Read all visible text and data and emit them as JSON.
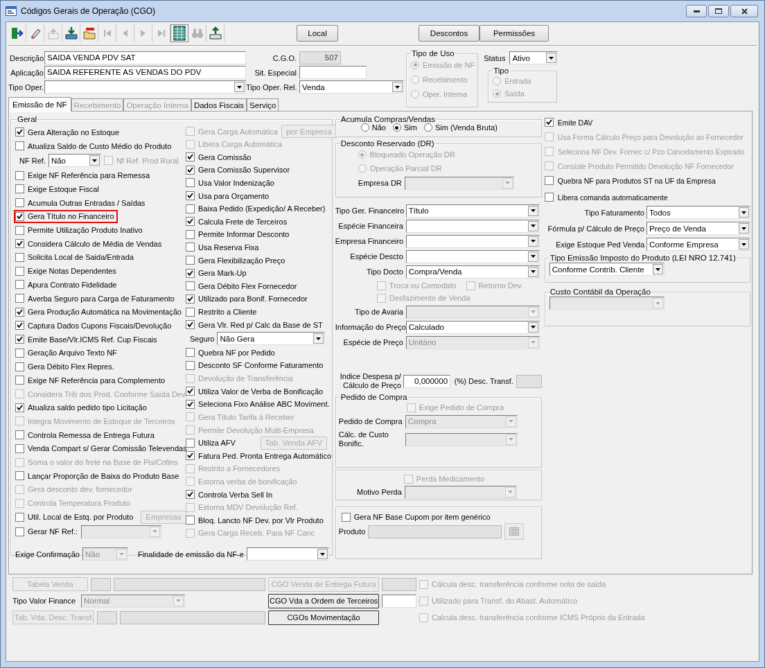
{
  "window": {
    "title": "Códigos Gerais de Operação (CGO)"
  },
  "toolbar": {
    "tools": [
      {
        "kind": "exit",
        "disabled": false
      },
      {
        "kind": "edit",
        "disabled": false
      },
      {
        "kind": "add",
        "disabled": true
      },
      {
        "kind": "download",
        "disabled": false
      },
      {
        "kind": "folder",
        "disabled": false
      },
      {
        "kind": "first",
        "disabled": true
      },
      {
        "kind": "prev",
        "disabled": true
      },
      {
        "kind": "next",
        "disabled": true
      },
      {
        "kind": "last",
        "disabled": true
      },
      {
        "kind": "grid",
        "disabled": false
      },
      {
        "kind": "binoculars",
        "disabled": true
      },
      {
        "kind": "upload",
        "disabled": false
      }
    ],
    "buttons": [
      {
        "label": "Local"
      },
      {
        "label": "Descontos"
      },
      {
        "label": "Permissões"
      }
    ]
  },
  "header": {
    "descricao": {
      "label": "Descrição",
      "value": "SAIDA VENDA PDV SAT"
    },
    "aplicacao": {
      "label": "Aplicação",
      "value": "SAIDA REFERENTE AS VENDAS DO PDV"
    },
    "tipo_oper": {
      "label": "Tipo Oper."
    },
    "cgo": {
      "label": "C.G.O.",
      "value": "507",
      "disabled": true
    },
    "sit_especial": {
      "label": "Sit. Especial"
    },
    "tipo_oper_rel": {
      "label": "Tipo Oper. Rel.",
      "value": "Venda"
    },
    "tipo_de_uso": {
      "title": "Tipo de Uso",
      "disabled": true,
      "options": [
        {
          "label": "Emissão de NF",
          "selected": true
        },
        {
          "label": "Recebimento",
          "selected": false
        },
        {
          "label": "Oper. Interna",
          "selected": false
        }
      ]
    },
    "status": {
      "label": "Status",
      "value": "Ativo"
    },
    "tipo": {
      "title": "Tipo",
      "disabled": true,
      "options": [
        {
          "label": "Entrada",
          "selected": false
        },
        {
          "label": "Saída",
          "selected": true
        }
      ]
    }
  },
  "tabs": [
    {
      "label": "Emissão de NF",
      "selected": true,
      "disabled": false
    },
    {
      "label": "Recebimento",
      "selected": false,
      "disabled": true
    },
    {
      "label": "Operação Interna",
      "selected": false,
      "disabled": true
    },
    {
      "label": "Dados Fiscais",
      "selected": false,
      "disabled": false
    },
    {
      "label": "Serviço",
      "selected": false,
      "disabled": false
    }
  ],
  "geral": {
    "title": "Geral",
    "column_1": [
      {
        "kind": "check",
        "label": "Gera Alteração no Estoque",
        "checked": true,
        "disabled": false,
        "highlighted": false
      },
      {
        "kind": "check",
        "label": "Atualiza Saldo de Custo Médio do Produto",
        "checked": false,
        "disabled": false,
        "highlighted": false
      },
      {
        "kind": "select",
        "label": "NF Ref.",
        "value": "Não",
        "disabled": false,
        "check": {
          "label": "Nf Ref. Prod Rural",
          "checked": false,
          "disabled": true
        },
        "highlighted": false
      },
      {
        "kind": "check",
        "label": "Exige NF Referência para Remessa",
        "checked": false,
        "disabled": false,
        "highlighted": false
      },
      {
        "kind": "check",
        "label": "Exige Estoque Fiscal",
        "checked": false,
        "disabled": false,
        "highlighted": false
      },
      {
        "kind": "check",
        "label": "Acumula Outras Entradas / Saídas",
        "checked": false,
        "disabled": false,
        "highlighted": false
      },
      {
        "kind": "check",
        "label": "Gera Título no Financeiro",
        "checked": true,
        "disabled": false,
        "highlighted": true
      },
      {
        "kind": "check",
        "label": "Permite Utilização Produto Inativo",
        "checked": false,
        "disabled": false,
        "highlighted": false
      },
      {
        "kind": "check",
        "label": "Considera Cálculo de Média de Vendas",
        "checked": true,
        "disabled": false,
        "highlighted": false
      },
      {
        "kind": "check",
        "label": "Solicita Local de Saida/Entrada",
        "checked": false,
        "disabled": false,
        "highlighted": false
      },
      {
        "kind": "check",
        "label": "Exige Notas Dependentes",
        "checked": false,
        "disabled": false,
        "highlighted": false
      },
      {
        "kind": "check",
        "label": "Apura Contrato Fidelidade",
        "checked": false,
        "disabled": false,
        "highlighted": false
      },
      {
        "kind": "check",
        "label": "Averba Seguro para Carga de Faturamento",
        "checked": false,
        "disabled": false,
        "highlighted": false
      },
      {
        "kind": "check",
        "label": "Gera Produção Automática na Movimentação",
        "checked": true,
        "disabled": false,
        "highlighted": false
      },
      {
        "kind": "check",
        "label": "Captura Dados Cupons Fiscais/Devolução",
        "checked": true,
        "disabled": false,
        "highlighted": false
      },
      {
        "kind": "check",
        "label": "Emite Base/Vlr.ICMS Ref. Cup Fiscais",
        "checked": true,
        "disabled": false,
        "highlighted": false
      },
      {
        "kind": "check",
        "label": "Geração Arquivo Texto NF",
        "checked": false,
        "disabled": false,
        "highlighted": false
      },
      {
        "kind": "check",
        "label": "Gera Débito Flex Repres.",
        "checked": false,
        "disabled": false,
        "highlighted": false
      },
      {
        "kind": "check",
        "label": "Exige NF Referência para Complemento",
        "checked": false,
        "disabled": false,
        "highlighted": false
      },
      {
        "kind": "check",
        "label": "Considera Trib dos Prod. Conforme Saída Dev.",
        "checked": false,
        "disabled": true,
        "highlighted": false
      },
      {
        "kind": "check",
        "label": "Atualiza saldo pedido tipo Licitação",
        "checked": true,
        "disabled": false,
        "highlighted": false
      },
      {
        "kind": "check",
        "label": "Integra Movimento de Estoque de Terceiros",
        "checked": false,
        "disabled": true,
        "highlighted": false
      },
      {
        "kind": "check",
        "label": "Controla Remessa de Entrega Futura",
        "checked": false,
        "disabled": false,
        "highlighted": false
      },
      {
        "kind": "check",
        "label": "Venda Compart s/ Gerar Comissão Televendas",
        "checked": false,
        "disabled": false,
        "highlighted": false
      },
      {
        "kind": "check",
        "label": "Soma o valor do frete na Base de Pis/Cofins",
        "checked": false,
        "disabled": true,
        "highlighted": false
      },
      {
        "kind": "check",
        "label": "Lançar Proporção de Baixa do Produto Base",
        "checked": false,
        "disabled": false,
        "highlighted": false
      },
      {
        "kind": "check",
        "label": "Gera desconto dev. fornecedor",
        "checked": false,
        "disabled": true,
        "highlighted": false
      },
      {
        "kind": "check",
        "label": "Controla Temperatura Produto",
        "checked": false,
        "disabled": true,
        "highlighted": false
      },
      {
        "kind": "check",
        "label": "Util. Local de Estq. por Produto",
        "checked": false,
        "disabled": false,
        "button": {
          "label": "Empresas",
          "disabled": true
        },
        "highlighted": false
      },
      {
        "kind": "check",
        "label": "Gerar NF Ref.:",
        "checked": false,
        "disabled": false,
        "select": {
          "disabled": true
        },
        "highlighted": false
      }
    ],
    "column_2": [
      {
        "kind": "check",
        "label": "Gera Carga Automática",
        "checked": false,
        "disabled": true,
        "button": {
          "label": "por Empresa",
          "disabled": true
        }
      },
      {
        "kind": "check",
        "label": "Libera Carga Automática",
        "checked": false,
        "disabled": true
      },
      {
        "kind": "check",
        "label": "Gera Comissão",
        "checked": true,
        "disabled": false
      },
      {
        "kind": "check",
        "label": "Gera Comissão Supervisor",
        "checked": true,
        "disabled": false
      },
      {
        "kind": "check",
        "label": "Usa Valor Indenização",
        "checked": false,
        "disabled": false
      },
      {
        "kind": "check",
        "label": "Usa para Orçamento",
        "checked": true,
        "disabled": false
      },
      {
        "kind": "check",
        "label": "Baixa Pedido (Expedição/ A Receber)",
        "checked": false,
        "disabled": false
      },
      {
        "kind": "check",
        "label": "Calcula Frete de Terceiros",
        "checked": true,
        "disabled": false
      },
      {
        "kind": "check",
        "label": "Permite Informar Desconto",
        "checked": false,
        "disabled": false
      },
      {
        "kind": "check",
        "label": "Usa Reserva Fixa",
        "checked": false,
        "disabled": false
      },
      {
        "kind": "check",
        "label": "Gera Flexibilização Preço",
        "checked": false,
        "disabled": false
      },
      {
        "kind": "check",
        "label": "Gera Mark-Up",
        "checked": true,
        "disabled": false
      },
      {
        "kind": "check",
        "label": "Gera Débito Flex Fornecedor",
        "checked": false,
        "disabled": false
      },
      {
        "kind": "check",
        "label": "Utilizado para Bonif. Fornecedor",
        "checked": true,
        "disabled": false
      },
      {
        "kind": "check",
        "label": "Restrito a Cliente",
        "checked": false,
        "disabled": false
      },
      {
        "kind": "check",
        "label": "Gera Vlr. Red p/ Calc da Base de ST",
        "checked": true,
        "disabled": false
      },
      {
        "kind": "select",
        "label": "Seguro",
        "value": "Não Gera",
        "disabled": false
      },
      {
        "kind": "check",
        "label": "Quebra NF por Pedido",
        "checked": false,
        "disabled": false
      },
      {
        "kind": "check",
        "label": "Desconto SF Conforme Faturamento",
        "checked": false,
        "disabled": false
      },
      {
        "kind": "check",
        "label": "Devolução de Transferência",
        "checked": false,
        "disabled": true
      },
      {
        "kind": "check",
        "label": "Utiliza Valor de Verba de Bonificação",
        "checked": true,
        "disabled": false
      },
      {
        "kind": "check",
        "label": "Seleciona Fixo Análise ABC Moviment.",
        "checked": true,
        "disabled": false
      },
      {
        "kind": "check",
        "label": "Gera Título Tarifa à Receber",
        "checked": false,
        "disabled": true
      },
      {
        "kind": "check",
        "label": "Permite Devolução Multi-Empresa",
        "checked": false,
        "disabled": true
      },
      {
        "kind": "check",
        "label": "Utiliza AFV",
        "checked": false,
        "disabled": false,
        "button": {
          "label": "Tab. Venda AFV",
          "disabled": true
        }
      },
      {
        "kind": "check",
        "label": "Fatura Ped. Pronta Entrega Automático",
        "checked": true,
        "disabled": false
      },
      {
        "kind": "check",
        "label": "Restrito a Fornecedores",
        "checked": false,
        "disabled": true
      },
      {
        "kind": "check",
        "label": "Estorna verba de bonificação",
        "checked": false,
        "disabled": true
      },
      {
        "kind": "check",
        "label": "Controla Verba Sell In",
        "checked": true,
        "disabled": false
      },
      {
        "kind": "check",
        "label": "Estorna MDV Devolução Ref.",
        "checked": false,
        "disabled": true
      },
      {
        "kind": "check",
        "label": "Bloq. Lancto NF Dev. por Vlr Produto",
        "checked": false,
        "disabled": false
      },
      {
        "kind": "check",
        "label": "Gera Carga Receb. Para NF Canc",
        "checked": false,
        "disabled": true
      }
    ],
    "exige_confirmacao": {
      "label": "Exige Confirmação",
      "value": "Não",
      "disabled": true
    },
    "finalidade": {
      "label": "Finalidade de emissão da NF-e",
      "disabled": false
    }
  },
  "column_3": {
    "acumula": {
      "title": "Acumula Compras/Vendas",
      "options": [
        {
          "label": "Não",
          "selected": false
        },
        {
          "label": "Sim",
          "selected": true
        },
        {
          "label": "Sim (Venda Bruta)",
          "selected": false
        }
      ]
    },
    "desconto_reservado": {
      "title": "Desconto Reservado (DR)",
      "disabled": true,
      "options": [
        {
          "label": "Bloqueado Operação DR",
          "selected": true
        },
        {
          "label": "Operação Parcial DR",
          "selected": false
        }
      ],
      "empresa": {
        "label": "Empresa DR",
        "disabled": true
      }
    },
    "fields": [
      {
        "kind": "select",
        "label": "Tipo Ger. Financeiro",
        "value": "Título",
        "disabled": false
      },
      {
        "kind": "select",
        "label": "Espécie Financeira",
        "disabled": false
      },
      {
        "kind": "select",
        "label": "Empresa Financeiro",
        "disabled": false
      },
      {
        "kind": "select",
        "label": "Espécie Descto",
        "disabled": false
      },
      {
        "kind": "select",
        "label": "Tipo Docto",
        "value": "Compra/Venda",
        "disabled": false
      },
      {
        "kind": "checks",
        "items": [
          {
            "label": "Troca ou Comodato",
            "checked": false,
            "disabled": true
          },
          {
            "label": "Retorno Dev.",
            "checked": false,
            "disabled": true
          }
        ]
      },
      {
        "kind": "checks",
        "items": [
          {
            "label": "Desfazimento de Venda",
            "checked": false,
            "disabled": true
          }
        ]
      },
      {
        "kind": "select",
        "label": "Tipo de Avaria",
        "disabled": true
      },
      {
        "kind": "select",
        "label": "Informação do Preço",
        "value": "Calculado",
        "disabled": false
      },
      {
        "kind": "select",
        "label": "Espécie de Preço",
        "value": "Unitário",
        "disabled": true
      }
    ],
    "indice": {
      "label": "Indice Despesa p/ Cálculo de Preço",
      "value": "0,000000",
      "desc_label": "(%) Desc. Transf."
    },
    "pedido_de_compra": {
      "title": "Pedido de Compra",
      "exige": {
        "label": "Exige Pedido de Compra",
        "checked": false,
        "disabled": true
      },
      "pedido": {
        "label": "Pedido de Compra",
        "value": "Compra",
        "disabled": true
      },
      "calc_custo": {
        "label": "Cálc. de Custo Bonific.",
        "disabled": true
      }
    },
    "perda": {
      "check": {
        "label": "Perda Medicamento",
        "checked": false,
        "disabled": true
      },
      "motivo": {
        "label": "Motivo Perda",
        "disabled": true
      }
    },
    "cupom": {
      "check": {
        "label": "Gera NF Base Cupom por item genérico",
        "checked": false,
        "disabled": false
      },
      "produto": {
        "label": "Produto",
        "disabled": true
      }
    }
  },
  "column_4": {
    "checks": [
      {
        "label": "Emite DAV",
        "checked": true,
        "disabled": false
      },
      {
        "label": "Usa Forma Cálculo Preço para Devolução ao Fornecedor",
        "checked": false,
        "disabled": true
      },
      {
        "label": "Seleciona NF Dev. Fornec c/ Pzo Cancelamento Expirado",
        "checked": false,
        "disabled": true
      },
      {
        "label": "Consiste Produto Permitido Devolução NF Fornecedor",
        "checked": false,
        "disabled": true
      },
      {
        "label": "Quebra NF para Produtos ST na UF da Empresa",
        "checked": false,
        "disabled": false
      },
      {
        "label": "Libera comanda automaticamente",
        "checked": false,
        "disabled": false
      }
    ],
    "selects": [
      {
        "label": "Tipo Faturamento",
        "value": "Todos"
      },
      {
        "label": "Fórmula p/ Cálculo de Preço",
        "value": "Preço de Venda"
      },
      {
        "label": "Exige Estoque Ped Venda",
        "value": "Conforme Empresa"
      }
    ],
    "imposto": {
      "title": "Tipo Emissão Imposto do Produto (LEI NRO 12.741)",
      "value": "Conforme Contrib. Cliente"
    },
    "custo": {
      "title": "Custo Contábil da Operação",
      "disabled": true
    }
  },
  "bottom": [
    {
      "kind": "button",
      "button": {
        "label": "Tabela Venda",
        "disabled": true
      },
      "cgo": {
        "label": "CGO Venda de Entrega Futura",
        "disabled": true,
        "field": {
          "disabled": true
        }
      },
      "check": {
        "label": "Cálcula desc. transferência conforme nota de saída",
        "checked": false,
        "disabled": true
      }
    },
    {
      "kind": "select",
      "label": "Tipo Valor Finance",
      "value": "Normal",
      "disabled": true,
      "cgo": {
        "label": "CGO Vda a Ordem de Terceiros",
        "disabled": false,
        "field": {
          "disabled": false
        }
      },
      "check": {
        "label": "Utilizado para Transf. do Abast. Automático",
        "checked": false,
        "disabled": true
      }
    },
    {
      "kind": "button",
      "button": {
        "label": "Tab. Vda. Desc. Transf.",
        "disabled": true
      },
      "cgo": {
        "label": "CGOs Movimentação",
        "disabled": false
      },
      "check": {
        "label": "Calcula desc. transferência conforme ICMS Próprio da Entrada",
        "checked": false,
        "disabled": true
      }
    }
  ]
}
